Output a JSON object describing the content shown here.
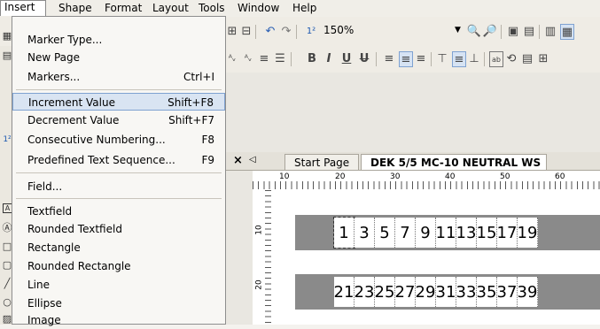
{
  "menubar": {
    "items": [
      "Insert",
      "Shape",
      "Format",
      "Layout",
      "Tools",
      "Window",
      "Help"
    ]
  },
  "toolbar": {
    "zoom": "150%"
  },
  "insert_menu": {
    "items": [
      {
        "label": "Marker Type...",
        "shortcut": ""
      },
      {
        "label": "New Page",
        "shortcut": ""
      },
      {
        "label": "Markers...",
        "shortcut": "Ctrl+I"
      },
      {
        "label": "Increment Value",
        "shortcut": "Shift+F8"
      },
      {
        "label": "Decrement Value",
        "shortcut": "Shift+F7"
      },
      {
        "label": "Consecutive Numbering...",
        "shortcut": "F8"
      },
      {
        "label": "Predefined Text Sequence...",
        "shortcut": "F9"
      },
      {
        "label": "Field...",
        "shortcut": ""
      },
      {
        "label": "Textfield",
        "shortcut": ""
      },
      {
        "label": "Rounded Textfield",
        "shortcut": ""
      },
      {
        "label": "Rectangle",
        "shortcut": ""
      },
      {
        "label": "Rounded Rectangle",
        "shortcut": ""
      },
      {
        "label": "Line",
        "shortcut": ""
      },
      {
        "label": "Ellipse",
        "shortcut": ""
      },
      {
        "label": "Image",
        "shortcut": ""
      }
    ]
  },
  "tabs": {
    "close": "×",
    "start": "Start Page",
    "active": "DEK 5/5 MC-10 NEUTRAL WS"
  },
  "ruler": {
    "marks": [
      "10",
      "20",
      "30",
      "40",
      "50",
      "60"
    ],
    "vmarks": [
      "10",
      "20"
    ]
  },
  "labels": {
    "row1": [
      "1",
      "3",
      "5",
      "7",
      "9",
      "11",
      "13",
      "15",
      "17",
      "19"
    ],
    "row2": [
      "21",
      "23",
      "25",
      "27",
      "29",
      "31",
      "33",
      "35",
      "37",
      "39"
    ]
  }
}
